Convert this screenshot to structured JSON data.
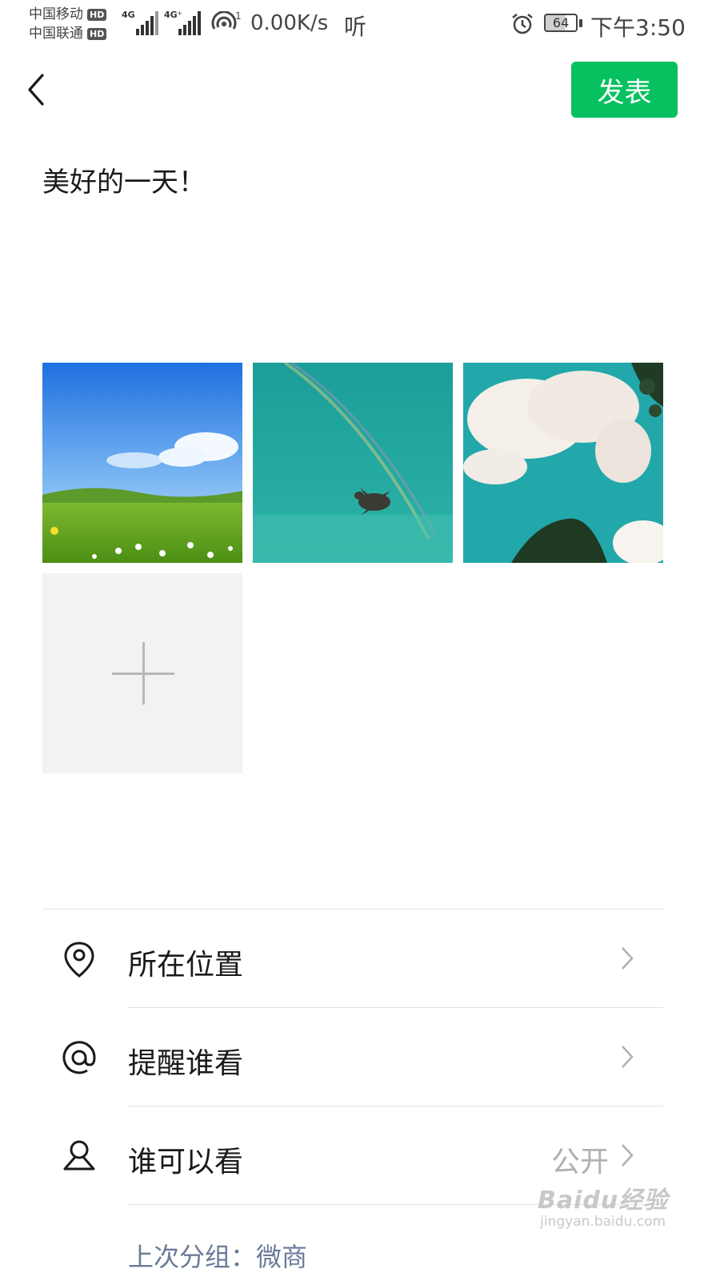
{
  "status_bar": {
    "carrier_1": "中国移动",
    "carrier_2": "中国联通",
    "hd": "HD",
    "network_1": "4G",
    "network_2": "4G⁺",
    "hotspot_count": "1",
    "net_speed": "0.00K/s",
    "listen_icon": "听",
    "battery": "64",
    "time": "下午3:50"
  },
  "header": {
    "back_icon": "chevron-left-icon",
    "publish_label": "发表",
    "accent_color": "#07c160"
  },
  "post": {
    "text": "美好的一天！"
  },
  "images": [
    {
      "name": "grassland-photo"
    },
    {
      "name": "sea-turtle-photo"
    },
    {
      "name": "clouds-sky-photo"
    }
  ],
  "add_tile_icon": "plus-icon",
  "options": {
    "location": {
      "label": "所在位置",
      "icon": "location-pin-icon"
    },
    "mention": {
      "label": "提醒谁看",
      "icon": "at-sign-icon"
    },
    "visibility": {
      "label": "谁可以看",
      "value": "公开",
      "icon": "person-icon"
    }
  },
  "last_group": "上次分组：微商",
  "watermark": {
    "line1": "Baidu经验",
    "line2": "jingyan.baidu.com"
  }
}
